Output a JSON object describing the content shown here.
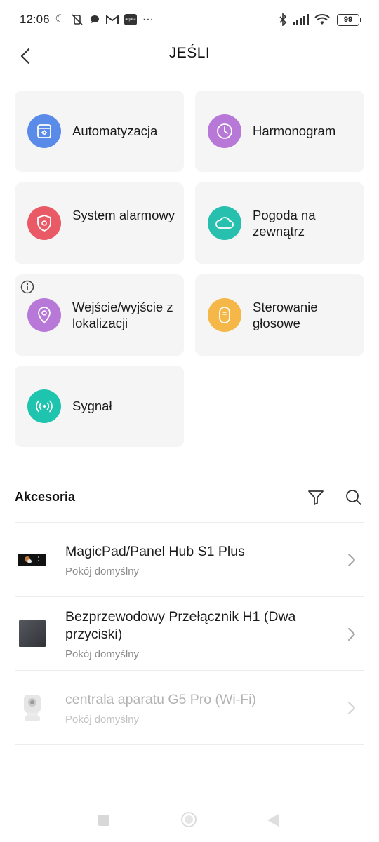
{
  "status_bar": {
    "time": "12:06",
    "battery": "99",
    "icons": [
      "moon-icon",
      "vibrate-off-icon",
      "chat-bubble-icon",
      "gmail-icon",
      "app-icon",
      "more-icon",
      "bluetooth-icon",
      "signal-icon",
      "wifi-icon",
      "battery-icon"
    ],
    "more": "···"
  },
  "header": {
    "title": "JEŚLI",
    "back_icon": "chevron-left-icon"
  },
  "tiles": [
    {
      "label": "Automatyzacja",
      "icon": "automation-icon",
      "color": "#5b8be8"
    },
    {
      "label": "Harmonogram",
      "icon": "clock-icon",
      "color": "#b778d8"
    },
    {
      "label": "System alarmowy",
      "icon": "shield-icon",
      "color": "#ea5a66"
    },
    {
      "label": "Pogoda na zewnątrz",
      "icon": "cloud-icon",
      "color": "#27bfae"
    },
    {
      "label": "Wejście/wyjście z lokalizacji",
      "icon": "location-pin-icon",
      "color": "#b778d8"
    },
    {
      "label": "Sterowanie głosowe",
      "icon": "voice-speaker-icon",
      "color": "#f4b748"
    },
    {
      "label": "Sygnał",
      "icon": "signal-broadcast-icon",
      "color": "#1fc4ae"
    }
  ],
  "accessories": {
    "title": "Akcesoria",
    "devices": [
      {
        "name": "MagicPad/Panel Hub S1 Plus",
        "room": "Pokój domyślny",
        "enabled": true
      },
      {
        "name": "Bezprzewodowy Przełącznik H1 (Dwa przyciski)",
        "room": "Pokój domyślny",
        "enabled": true
      },
      {
        "name": "centrala aparatu G5 Pro (Wi-Fi)",
        "room": "Pokój domyślny",
        "enabled": false
      }
    ]
  }
}
